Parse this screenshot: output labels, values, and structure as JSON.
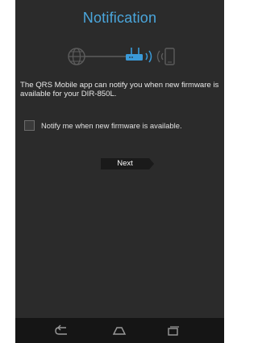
{
  "screen": {
    "title": "Notification",
    "description": "The QRS Mobile app can notify you when new firmware is available for your DIR-850L.",
    "notify_checkbox": {
      "label": "Notify me when new firmware is available.",
      "checked": false
    },
    "next_button": {
      "label": "Next"
    }
  },
  "topology": {
    "icons": [
      "globe-icon",
      "router-icon",
      "wireless-signal-icon",
      "mobile-phone-icon"
    ]
  },
  "navbar": {
    "icons": [
      "back-icon",
      "home-icon",
      "recent-apps-icon"
    ]
  },
  "colors": {
    "accent": "#4aa6dc",
    "background": "#2b2b2b",
    "navbar": "#151515",
    "button": "#1a1a1a"
  }
}
